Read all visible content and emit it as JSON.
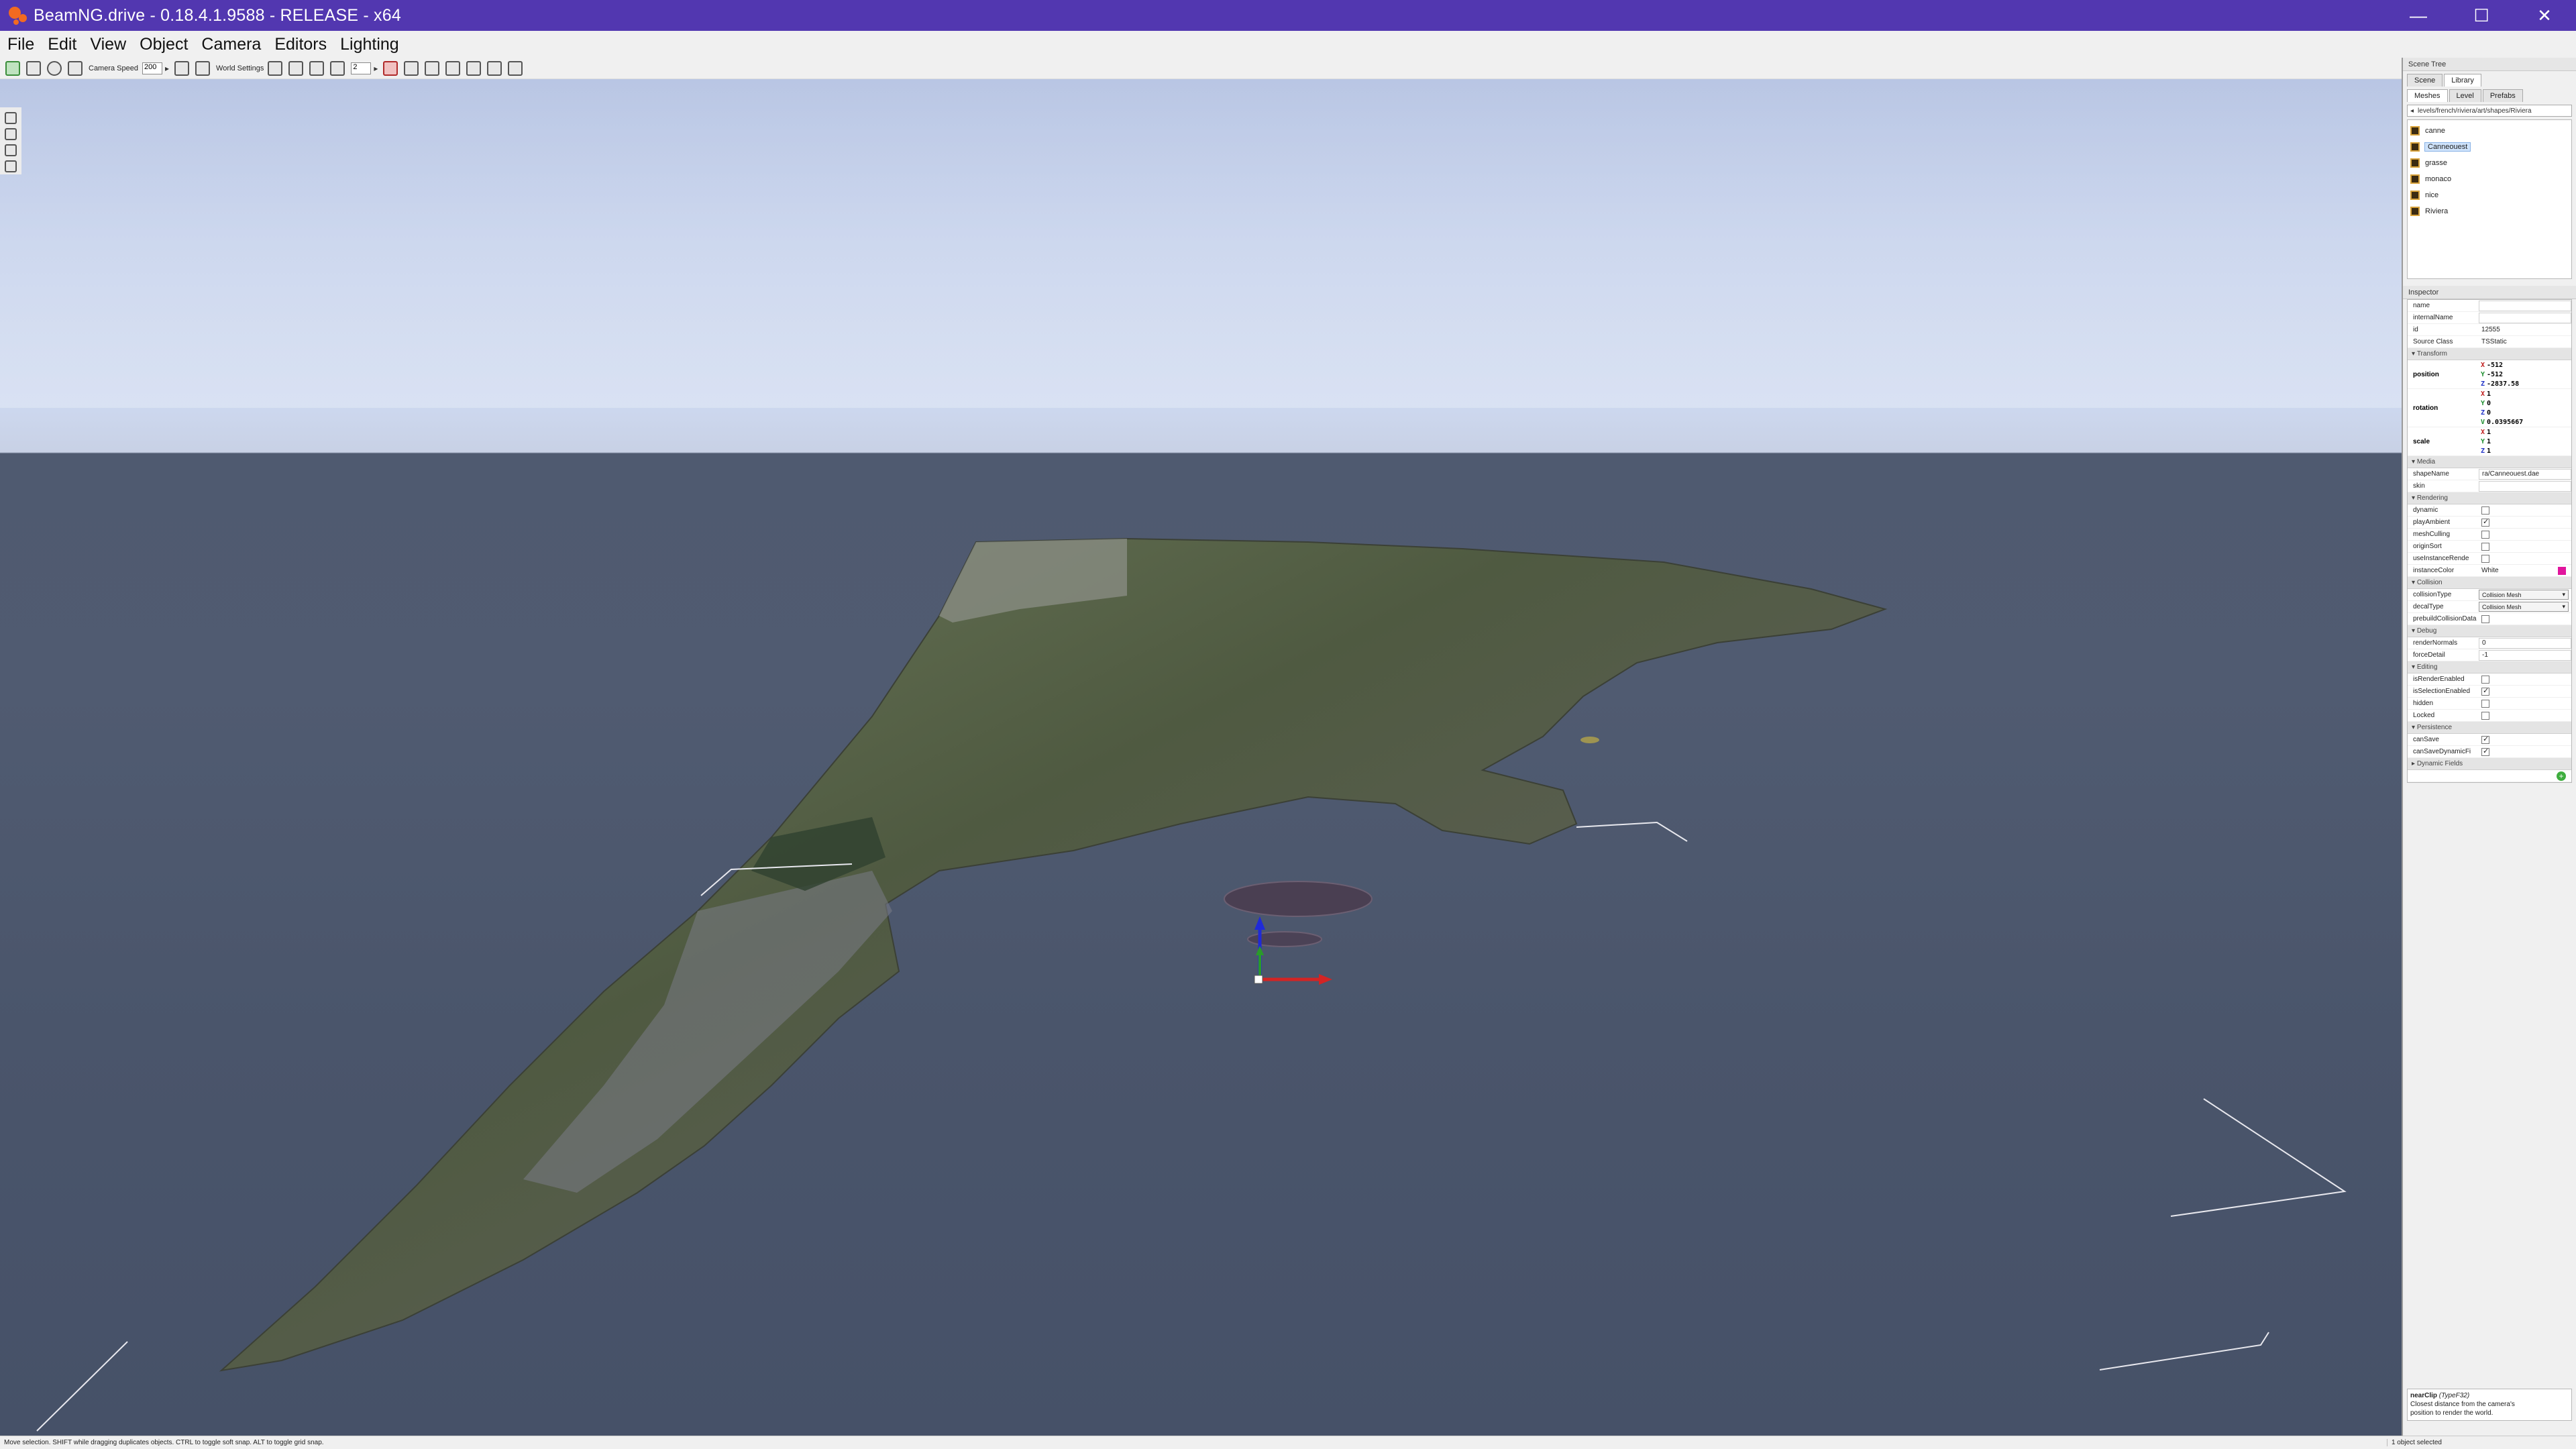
{
  "window": {
    "title": "BeamNG.drive - 0.18.4.1.9588 - RELEASE - x64",
    "minimize": "—",
    "maximize": "☐",
    "close": "✕"
  },
  "menu": {
    "items": [
      "File",
      "Edit",
      "View",
      "Object",
      "Camera",
      "Editors",
      "Lighting"
    ]
  },
  "toolbar": {
    "camera_speed_label": "Camera Speed",
    "camera_speed_value": "200",
    "world_settings_label": "World Settings",
    "snap_value": "2"
  },
  "scene_tree": {
    "header": "Scene Tree",
    "tabs": [
      "Scene",
      "Library"
    ],
    "active_tab": "Library",
    "subtabs": [
      "Meshes",
      "Level",
      "Prefabs"
    ],
    "path": "levels/french/riviera/art/shapes/Riviera",
    "meshes": [
      {
        "name": "canne",
        "selected": false
      },
      {
        "name": "Canneouest",
        "selected": true
      },
      {
        "name": "grasse",
        "selected": false
      },
      {
        "name": "monaco",
        "selected": false
      },
      {
        "name": "nice",
        "selected": false
      },
      {
        "name": "Riviera",
        "selected": false
      }
    ]
  },
  "inspector": {
    "header": "Inspector",
    "fields": {
      "name_label": "name",
      "name_value": "",
      "internal_label": "internalName",
      "internal_value": "",
      "id_label": "id",
      "id_value": "12555",
      "class_label": "Source Class",
      "class_value": "TSStatic"
    },
    "sections": {
      "transform": "Transform",
      "media": "Media",
      "rendering": "Rendering",
      "collision": "Collision",
      "debug": "Debug",
      "editing": "Editing",
      "persistence": "Persistence",
      "dynamic": "Dynamic Fields"
    },
    "position": {
      "label": "position",
      "x": "-512",
      "y": "-512",
      "z": "-2837.58"
    },
    "rotation": {
      "label": "rotation",
      "x": "1",
      "y": "0",
      "z": "0",
      "w": "0.0395667"
    },
    "scale": {
      "label": "scale",
      "x": "1",
      "y": "1",
      "z": "1"
    },
    "media": {
      "shapename_label": "shapeName",
      "shapename_value": "ra/Canneouest.dae",
      "skin_label": "skin",
      "skin_value": ""
    },
    "rendering": [
      {
        "label": "dynamic",
        "checked": false
      },
      {
        "label": "playAmbient",
        "checked": true
      },
      {
        "label": "meshCulling",
        "checked": false
      },
      {
        "label": "originSort",
        "checked": false
      },
      {
        "label": "useInstanceRende",
        "checked": false
      }
    ],
    "instance_color_label": "instanceColor",
    "instance_color_value": "White",
    "instance_color_hex": "#e1159d",
    "collision": {
      "collision_type_label": "collisionType",
      "collision_type_value": "Collision Mesh",
      "decal_type_label": "decalType",
      "decal_type_value": "Collision Mesh",
      "prebuild_label": "prebuildCollisionData"
    },
    "debug": {
      "render_normals_label": "renderNormals",
      "render_normals_value": "0",
      "force_detail_label": "forceDetail",
      "force_detail_value": "-1"
    },
    "editing": [
      {
        "label": "isRenderEnabled",
        "checked": false
      },
      {
        "label": "isSelectionEnabled",
        "checked": true
      },
      {
        "label": "hidden",
        "checked": false
      },
      {
        "label": "Locked",
        "checked": false
      }
    ],
    "persistence": [
      {
        "label": "canSave",
        "checked": true
      },
      {
        "label": "canSaveDynamicFi",
        "checked": true
      }
    ]
  },
  "help": {
    "title": "nearClip",
    "type": "(TypeF32)",
    "text1": "Closest distance from the camera's",
    "text2": "position to render the world."
  },
  "status": {
    "left": "Move selection.  SHIFT while dragging duplicates objects.  CTRL to toggle soft snap.  ALT to toggle grid snap.",
    "right": "1 object selected"
  },
  "colors": {
    "titlebar": "#5237b0",
    "sea": "#4f5a70",
    "sky": "#c6d2ec",
    "gizmo_x": "#d32424",
    "gizmo_y": "#2a9a2a",
    "gizmo_z": "#1f2ad8"
  }
}
